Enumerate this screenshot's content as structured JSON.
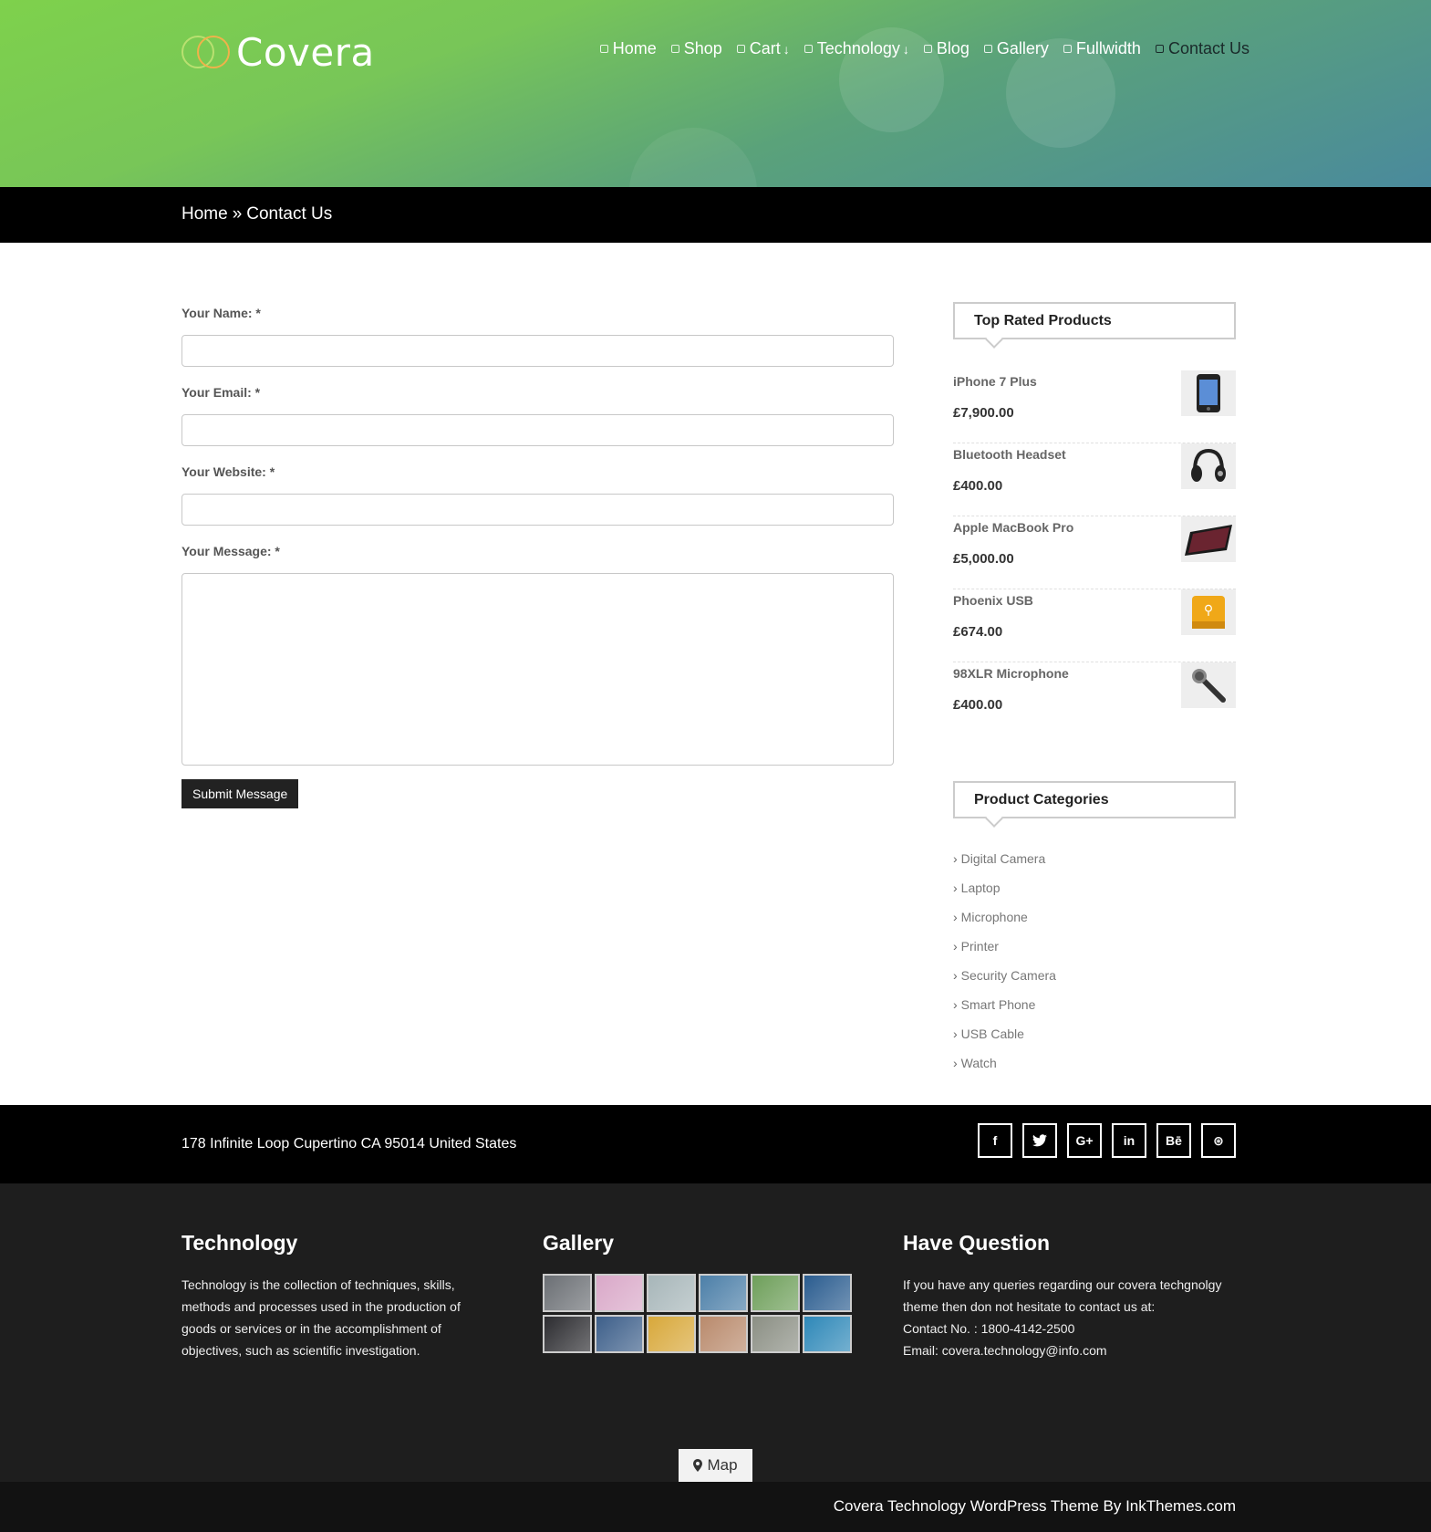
{
  "header": {
    "logo_text": "Covera",
    "nav": [
      {
        "label": "Home",
        "has_dropdown": false
      },
      {
        "label": "Shop",
        "has_dropdown": false
      },
      {
        "label": "Cart",
        "has_dropdown": true
      },
      {
        "label": "Technology",
        "has_dropdown": true
      },
      {
        "label": "Blog",
        "has_dropdown": false
      },
      {
        "label": "Gallery",
        "has_dropdown": false
      },
      {
        "label": "Fullwidth",
        "has_dropdown": false
      },
      {
        "label": "Contact Us",
        "has_dropdown": false,
        "active": true
      }
    ],
    "dropdown_arrow": "↓"
  },
  "breadcrumb": {
    "home": "Home",
    "separator": "»",
    "current": "Contact Us"
  },
  "form": {
    "name_label": "Your Name: *",
    "email_label": "Your Email: *",
    "website_label": "Your Website: *",
    "message_label": "Your Message: *",
    "name_value": "",
    "email_value": "",
    "website_value": "",
    "message_value": "",
    "submit_label": "Submit Message"
  },
  "sidebar": {
    "top_rated_title": "Top Rated Products",
    "products": [
      {
        "name": "iPhone 7 Plus",
        "price": "£7,900.00",
        "icon": "phone-icon"
      },
      {
        "name": "Bluetooth Headset",
        "price": "£400.00",
        "icon": "headset-icon"
      },
      {
        "name": "Apple MacBook Pro",
        "price": "£5,000.00",
        "icon": "tablet-icon"
      },
      {
        "name": "Phoenix USB",
        "price": "£674.00",
        "icon": "usb-drive-icon"
      },
      {
        "name": "98XLR Microphone",
        "price": "£400.00",
        "icon": "microphone-icon"
      }
    ],
    "categories_title": "Product Categories",
    "categories": [
      "Digital Camera",
      "Laptop",
      "Microphone",
      "Printer",
      "Security Camera",
      "Smart Phone",
      "USB Cable",
      "Watch"
    ]
  },
  "footer_bar": {
    "address": "178 Infinite Loop Cupertino CA 95014 United States",
    "social": [
      {
        "label": "f",
        "icon": "facebook-icon"
      },
      {
        "label": "🐦",
        "icon": "twitter-icon"
      },
      {
        "label": "G+",
        "icon": "google-plus-icon"
      },
      {
        "label": "in",
        "icon": "linkedin-icon"
      },
      {
        "label": "Bē",
        "icon": "behance-icon"
      },
      {
        "label": "⊛",
        "icon": "dribbble-icon"
      }
    ]
  },
  "footer": {
    "technology_title": "Technology",
    "technology_text": "Technology is the collection of techniques, skills, methods and processes used in the production of goods or services or in the accomplishment of objectives, such as scientific investigation.",
    "gallery_title": "Gallery",
    "gallery_colors": [
      "#6b6f74",
      "#d9a8c8",
      "#a7b6b9",
      "#4c7fa8",
      "#6e9f5a",
      "#2a5c8f",
      "#2c2c30",
      "#3d5f8a",
      "#d8a83a",
      "#b98a6c",
      "#8b8f84",
      "#2e88b8"
    ],
    "question_title": "Have Question",
    "question_text": "If you have any queries regarding our covera techgnolgy theme then don not hesitate to contact us at:",
    "contact_no": "Contact No. : 1800-4142-2500",
    "email": "Email: covera.technology@info.com",
    "map_label": "Map"
  },
  "copyright": "Covera Technology WordPress Theme By InkThemes.com",
  "colors": {
    "header_start": "#7ed14c",
    "header_end": "#4a8a9c",
    "dark": "#000000",
    "footer": "#1e1e1e"
  }
}
